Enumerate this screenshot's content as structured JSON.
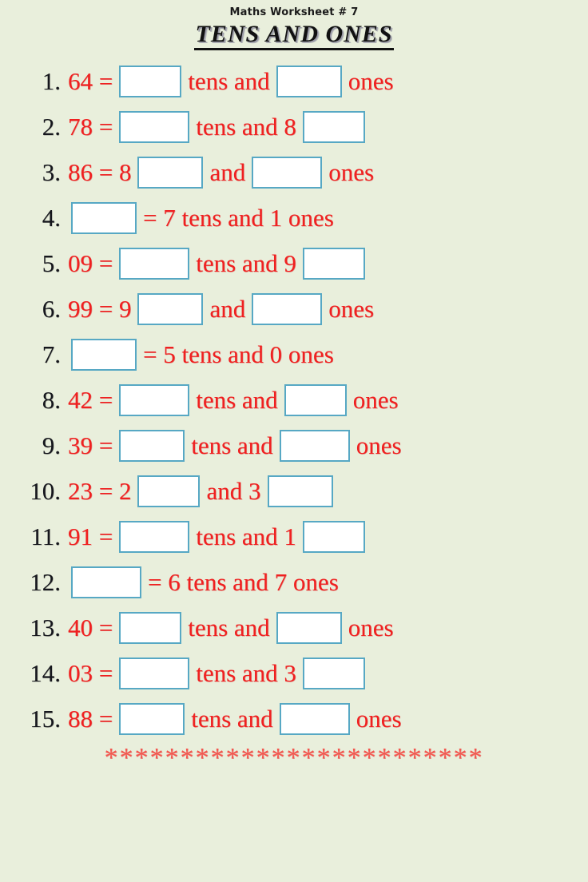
{
  "header": {
    "worksheet_label": "Maths Worksheet # 7",
    "title": "TENS AND ONES"
  },
  "colors": {
    "background": "#e9efdc",
    "text_red": "#f02020",
    "number_black": "#15161c",
    "box_border": "#57a8c4",
    "box_fill": "#ffffff",
    "stars_red": "#f4564e"
  },
  "problems": [
    {
      "number": "1.",
      "parts": [
        {
          "type": "text",
          "value": "64 ="
        },
        {
          "type": "blank"
        },
        {
          "type": "text",
          "value": "tens and"
        },
        {
          "type": "blank"
        },
        {
          "type": "text",
          "value": "ones"
        }
      ]
    },
    {
      "number": "2.",
      "parts": [
        {
          "type": "text",
          "value": "78 ="
        },
        {
          "type": "blank"
        },
        {
          "type": "text",
          "value": "tens and  8"
        },
        {
          "type": "blank"
        }
      ]
    },
    {
      "number": "3.",
      "parts": [
        {
          "type": "text",
          "value": "86 = 8"
        },
        {
          "type": "blank"
        },
        {
          "type": "text",
          "value": "and"
        },
        {
          "type": "blank"
        },
        {
          "type": "text",
          "value": "ones"
        }
      ]
    },
    {
      "number": "4.",
      "parts": [
        {
          "type": "blank"
        },
        {
          "type": "text",
          "value": "= 7 tens and 1 ones"
        }
      ]
    },
    {
      "number": "5.",
      "parts": [
        {
          "type": "text",
          "value": "09 ="
        },
        {
          "type": "blank"
        },
        {
          "type": "text",
          "value": "tens and 9"
        },
        {
          "type": "blank"
        }
      ]
    },
    {
      "number": "6.",
      "parts": [
        {
          "type": "text",
          "value": "99 = 9"
        },
        {
          "type": "blank"
        },
        {
          "type": "text",
          "value": "and"
        },
        {
          "type": "blank"
        },
        {
          "type": "text",
          "value": "ones"
        }
      ]
    },
    {
      "number": "7.",
      "parts": [
        {
          "type": "blank"
        },
        {
          "type": "text",
          "value": "= 5 tens and 0 ones"
        }
      ]
    },
    {
      "number": "8.",
      "parts": [
        {
          "type": "text",
          "value": "42 ="
        },
        {
          "type": "blank"
        },
        {
          "type": "text",
          "value": "tens and"
        },
        {
          "type": "blank"
        },
        {
          "type": "text",
          "value": "ones"
        }
      ]
    },
    {
      "number": "9.",
      "parts": [
        {
          "type": "text",
          "value": "39 ="
        },
        {
          "type": "blank"
        },
        {
          "type": "text",
          "value": "tens and"
        },
        {
          "type": "blank"
        },
        {
          "type": "text",
          "value": "ones"
        }
      ]
    },
    {
      "number": "10.",
      "parts": [
        {
          "type": "text",
          "value": "23 = 2"
        },
        {
          "type": "blank"
        },
        {
          "type": "text",
          "value": "and 3"
        },
        {
          "type": "blank"
        }
      ]
    },
    {
      "number": "11.",
      "parts": [
        {
          "type": "text",
          "value": "91 ="
        },
        {
          "type": "blank"
        },
        {
          "type": "text",
          "value": "tens and 1"
        },
        {
          "type": "blank"
        }
      ]
    },
    {
      "number": "12.",
      "parts": [
        {
          "type": "blank"
        },
        {
          "type": "text",
          "value": "= 6 tens and 7 ones"
        }
      ]
    },
    {
      "number": "13.",
      "parts": [
        {
          "type": "text",
          "value": "40 ="
        },
        {
          "type": "blank"
        },
        {
          "type": "text",
          "value": "tens and"
        },
        {
          "type": "blank"
        },
        {
          "type": "text",
          "value": "ones"
        }
      ]
    },
    {
      "number": "14.",
      "parts": [
        {
          "type": "text",
          "value": "03 ="
        },
        {
          "type": "blank"
        },
        {
          "type": "text",
          "value": "tens and 3"
        },
        {
          "type": "blank"
        }
      ]
    },
    {
      "number": "15.",
      "parts": [
        {
          "type": "text",
          "value": "88 ="
        },
        {
          "type": "blank"
        },
        {
          "type": "text",
          "value": "tens and"
        },
        {
          "type": "blank"
        },
        {
          "type": "text",
          "value": "ones"
        }
      ]
    }
  ],
  "footer": {
    "stars": "*************************"
  }
}
